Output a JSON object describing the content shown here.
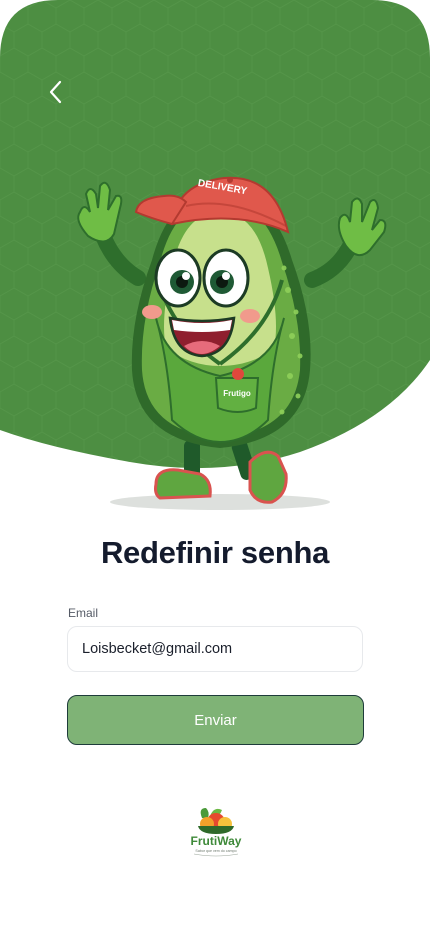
{
  "header": {
    "back_icon": "chevron-left-icon"
  },
  "colors": {
    "hero_green": "#4d8e42",
    "primary_button": "#7fb376",
    "button_border": "#1e3c3a",
    "title": "#141b2d"
  },
  "mascot": {
    "cap_text": "DELIVERY",
    "pocket_text": "Frutigo"
  },
  "form": {
    "title": "Redefinir senha",
    "email_label": "Email",
    "email_value": "Loisbecket@gmail.com",
    "submit_label": "Enviar"
  },
  "brand": {
    "name": "FrutiWay",
    "tagline": "Sabor que vem do campo"
  }
}
